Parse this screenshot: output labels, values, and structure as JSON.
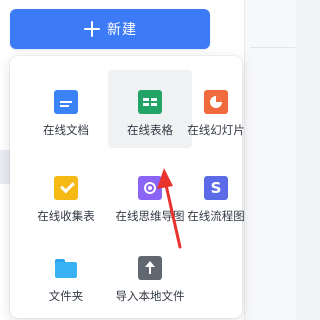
{
  "new_button": {
    "label": "新建"
  },
  "menu": {
    "items": [
      {
        "label": "在线文档",
        "icon": "doc-icon"
      },
      {
        "label": "在线表格",
        "icon": "sheet-icon"
      },
      {
        "label": "在线幻灯片",
        "icon": "slide-icon"
      },
      {
        "label": "在线收集表",
        "icon": "collect-icon"
      },
      {
        "label": "在线思维导图",
        "icon": "mindmap-icon"
      },
      {
        "label": "在线流程图",
        "icon": "flowchart-icon"
      },
      {
        "label": "文件夹",
        "icon": "folder-icon"
      },
      {
        "label": "导入本地文件",
        "icon": "upload-icon"
      }
    ]
  },
  "colors": {
    "accent": "#3c7bf5",
    "annotation_arrow": "#e8332f"
  }
}
